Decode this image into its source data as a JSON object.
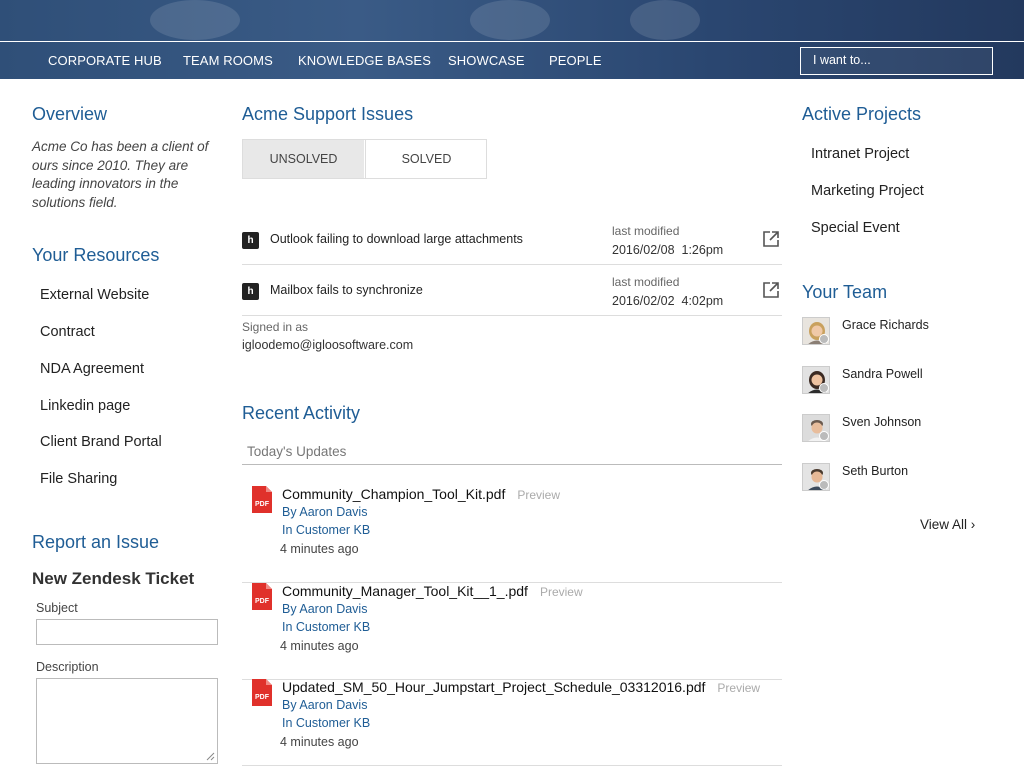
{
  "nav": {
    "items": [
      "CORPORATE HUB",
      "TEAM ROOMS",
      "KNOWLEDGE BASES",
      "SHOWCASE",
      "PEOPLE"
    ],
    "search_label": "I want to..."
  },
  "left": {
    "overview_title": "Overview",
    "overview_text": "Acme Co has been a client of ours since 2010. They are leading innovators in the solutions field.",
    "resources_title": "Your Resources",
    "resources": [
      "External Website",
      "Contract",
      "NDA Agreement",
      "Linkedin page",
      "Client Brand Portal",
      "File Sharing"
    ],
    "report_title": "Report an Issue",
    "ticket_title": "New Zendesk Ticket",
    "subject_label": "Subject",
    "description_label": "Description"
  },
  "support": {
    "title": "Acme Support Issues",
    "tabs": [
      "UNSOLVED",
      "SOLVED"
    ],
    "issues": [
      {
        "badge": "h",
        "title": "Outlook failing to download large attachments",
        "modified_label": "last modified",
        "date": "2016/02/08  1:26pm"
      },
      {
        "badge": "h",
        "title": "Mailbox fails to synchronize",
        "modified_label": "last modified",
        "date": "2016/02/02  4:02pm"
      }
    ],
    "signed_in_label": "Signed in as",
    "signed_in_email": "igloodemo@igloosoftware.com"
  },
  "activity": {
    "title": "Recent Activity",
    "section": "Today's Updates",
    "items": [
      {
        "file": "Community_Champion_Tool_Kit.pdf",
        "preview": "Preview",
        "by": "By Aaron Davis",
        "in": "In Customer KB",
        "time": "4 minutes ago"
      },
      {
        "file": "Community_Manager_Tool_Kit__1_.pdf",
        "preview": "Preview",
        "by": "By Aaron Davis",
        "in": "In Customer KB",
        "time": "4 minutes ago"
      },
      {
        "file": "Updated_SM_50_Hour_Jumpstart_Project_Schedule_03312016.pdf",
        "preview": "Preview",
        "by": "By Aaron Davis",
        "in": "In Customer KB",
        "time": "4 minutes ago"
      }
    ]
  },
  "right": {
    "projects_title": "Active Projects",
    "projects": [
      "Intranet Project",
      "Marketing Project",
      "Special Event"
    ],
    "team_title": "Your Team",
    "team": [
      "Grace Richards",
      "Sandra Powell",
      "Sven Johnson",
      "Seth Burton"
    ],
    "view_all": "View All ›"
  },
  "colors": {
    "header_bg": "#2f4f78",
    "accent": "#1f5d95",
    "pdf_red": "#e0312b"
  }
}
